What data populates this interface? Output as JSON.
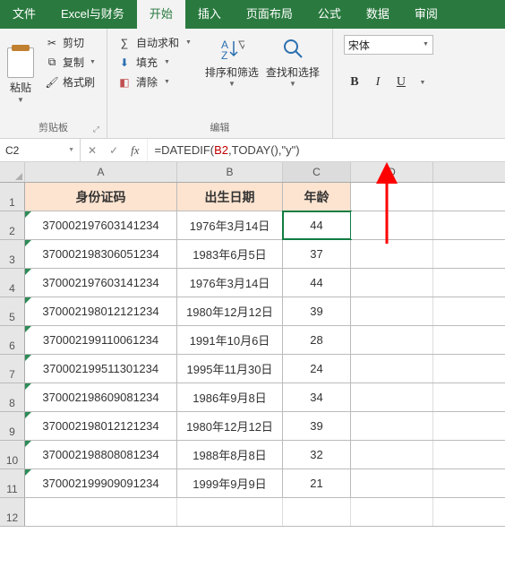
{
  "tabs": [
    "文件",
    "Excel与财务",
    "开始",
    "插入",
    "页面布局",
    "公式",
    "数据",
    "审阅"
  ],
  "active_tab_index": 2,
  "ribbon": {
    "clipboard": {
      "paste": "粘贴",
      "cut": "剪切",
      "copy": "复制",
      "format_painter": "格式刷",
      "group_label": "剪贴板"
    },
    "editing": {
      "autosum": "自动求和",
      "fill": "填充",
      "clear": "清除",
      "sort_filter": "排序和筛选",
      "find_select": "查找和选择",
      "group_label": "编辑"
    },
    "font": {
      "font_name": "宋体",
      "bold": "B",
      "italic": "I",
      "underline": "U"
    }
  },
  "namebox": "C2",
  "formula_prefix": "=DATEDIF(",
  "formula_arg": "B2",
  "formula_suffix": ",TODAY(),\"y\")",
  "columns": [
    "A",
    "B",
    "C",
    "D"
  ],
  "headers": {
    "A": "身份证码",
    "B": "出生日期",
    "C": "年龄"
  },
  "rows": [
    {
      "A": "370002197603141234",
      "B": "1976年3月14日",
      "C": "44"
    },
    {
      "A": "370002198306051234",
      "B": "1983年6月5日",
      "C": "37"
    },
    {
      "A": "370002197603141234",
      "B": "1976年3月14日",
      "C": "44"
    },
    {
      "A": "370002198012121234",
      "B": "1980年12月12日",
      "C": "39"
    },
    {
      "A": "370002199110061234",
      "B": "1991年10月6日",
      "C": "28"
    },
    {
      "A": "370002199511301234",
      "B": "1995年11月30日",
      "C": "24"
    },
    {
      "A": "370002198609081234",
      "B": "1986年9月8日",
      "C": "34"
    },
    {
      "A": "370002198012121234",
      "B": "1980年12月12日",
      "C": "39"
    },
    {
      "A": "370002198808081234",
      "B": "1988年8月8日",
      "C": "32"
    },
    {
      "A": "370002199909091234",
      "B": "1999年9月9日",
      "C": "21"
    }
  ]
}
